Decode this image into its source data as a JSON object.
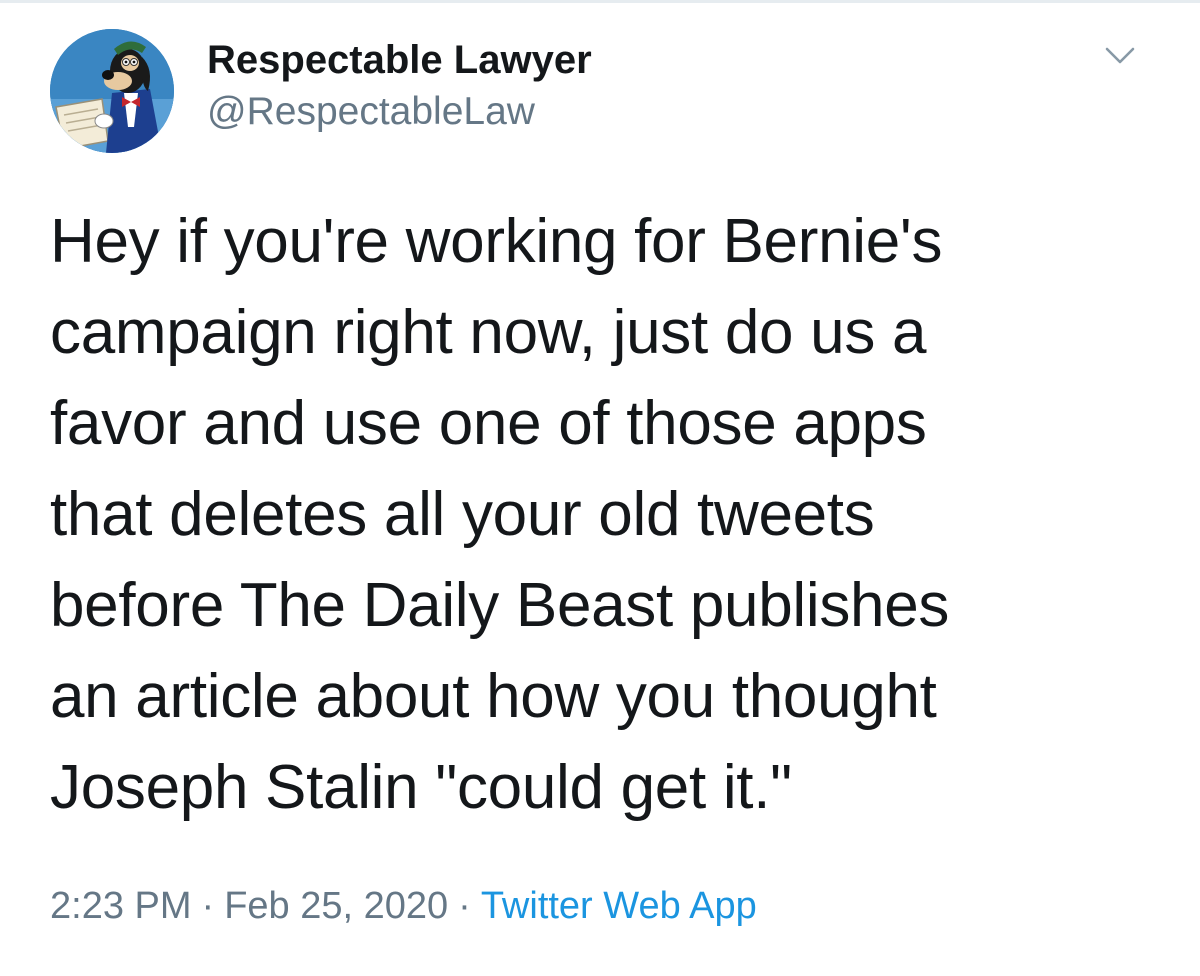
{
  "author": {
    "display_name": "Respectable Lawyer",
    "handle": "@RespectableLaw",
    "avatar_icon": "cartoon-dog-avatar-icon"
  },
  "menu": {
    "icon": "chevron-down-icon"
  },
  "tweet": {
    "lines": [
      "Hey if you're working for Bernie's",
      "campaign right now, just do us a",
      "favor and use one of those apps",
      "that deletes all your old tweets",
      "before The Daily Beast publishes",
      "an article about how you thought",
      "Joseph Stalin \"could get it.\""
    ]
  },
  "meta": {
    "time": "2:23 PM",
    "separator": "·",
    "date": "Feb 25, 2020",
    "source": "Twitter Web App"
  },
  "colors": {
    "text": "#14171a",
    "secondary": "#657786",
    "link": "#1b95e0",
    "divider": "#e6ecf0"
  }
}
